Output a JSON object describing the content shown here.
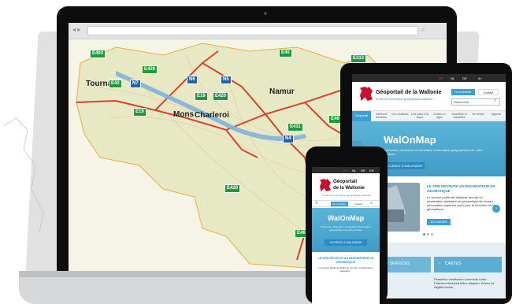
{
  "laptop": {
    "map_labels": [
      "Tournai",
      "Mons",
      "Charleroi",
      "Namur"
    ],
    "roads_green": [
      "E403",
      "E429",
      "E42",
      "E19",
      "E19",
      "E420",
      "E40",
      "E313",
      "E411",
      "E46",
      "E420",
      "E46"
    ],
    "roads_blue": [
      "N7",
      "N6",
      "N5",
      "N4"
    ],
    "roads_white": [
      "A8",
      "A7",
      "A4",
      "A15",
      "A3",
      "N4"
    ]
  },
  "tablet": {
    "langs": [
      "FR",
      "NL",
      "DE",
      "A+"
    ],
    "title": "Géoportail de la Wallonie",
    "subtitle": "Le site de l'information géographique wallonne",
    "btn_connect": "Se connecter",
    "btn_contact": "Contact",
    "search_placeholder": "Recherche",
    "nav": [
      "Géoportail",
      "Cartes et données",
      "Les coulisses",
      "Une carte à la loupe",
      "Cartes en ligne",
      "Nouvelles et actualités",
      "Se former",
      "Agenda"
    ],
    "hero_title": "WalOnMap",
    "hero_text": "Parcourez, découvrez et visualisez l'information géographique de votre territoire",
    "hero_button": "ACCÉDEZ À WALONMAP",
    "news_title": "LE SPW RECRUTE UN DESSINATEUR EN GÉOMATIQUE",
    "news_text": "Le service public de Wallonie recrute un dessinateur assistant en géomatique de niveau secondaire supérieur (m/f) pour la direction de la géomatique.",
    "news_button": "EN SAVOIR PLUS",
    "tile_services": "DONNÉES ET SERVICES",
    "tile_cartes": "CARTES",
    "tile_text": "Phasellus vestibulum commodo tortor. Praesent tincidunt tellus aliquam. Donec at sagittis lectus."
  },
  "phone": {
    "langs": [
      "FR",
      "NL",
      "DE",
      "EN"
    ],
    "title_line1": "Géoportail",
    "title_line2": "de la Wallonie",
    "subtitle": "Le site de l'information géographique wallonne",
    "btn_connect": "Se connecter",
    "btn_contact": "Contact",
    "hero_title": "WalOnMap",
    "hero_text": "Parcourez, découvrez et visualisez l'information géographique de votre territoire",
    "hero_button": "ACCÉDEZ À WALONMAP",
    "news_title": "LE SPW RECRUTE UN DESSINATEUR EN GÉOMATIQUE",
    "news_text": "Le service public de Wallonie recrute un dessinateur assistant..."
  },
  "colors": {
    "brand_blue": "#2d89c6",
    "brand_red": "#c8102e",
    "road_green": "#1f9a3a",
    "road_blue": "#2561a8"
  }
}
